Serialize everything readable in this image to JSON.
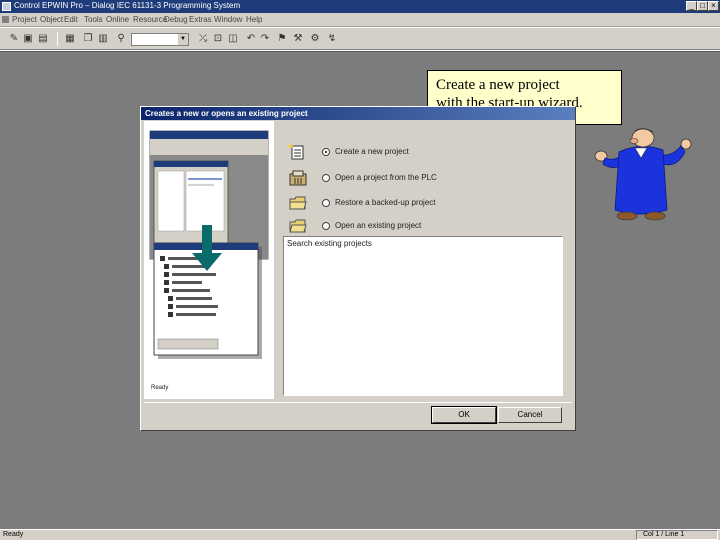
{
  "window": {
    "title": "Control EPWIN Pro – Dialog IEC 61131-3 Programming System",
    "buttons": [
      "_",
      "□",
      "×"
    ]
  },
  "menubar": {
    "items": [
      "Project",
      "Object",
      "Edit",
      "Tools",
      "Online",
      "Resource",
      "Debug",
      "Extras",
      "Window",
      "Help"
    ]
  },
  "toolbar": {
    "combo_value": ""
  },
  "callout": {
    "line1": "Create a new project",
    "line2": "with the start-up wizard."
  },
  "dialog": {
    "title": "Creates a new or opens an existing project",
    "options": [
      {
        "label": "Create a new project",
        "icon": "new-project-icon",
        "selected": true
      },
      {
        "label": "Open a project from the PLC",
        "icon": "plc-upload-icon",
        "selected": false
      },
      {
        "label": "Restore a backed-up project",
        "icon": "restore-folder-icon",
        "selected": false
      },
      {
        "label": "Open an existing project",
        "icon": "open-folder-icon",
        "selected": false
      }
    ],
    "list_label": "Search existing projects",
    "illustration_ready": "Ready",
    "ok_label": "OK",
    "cancel_label": "Cancel"
  },
  "statusbar": {
    "text": "Ready",
    "position": "Col 1 / Line 1"
  },
  "colors": {
    "titlebar": "#1f3c7a",
    "workspace": "#7c7c7c",
    "face": "#d4d0c8",
    "callout": "#ffffcc",
    "cartoon_suit": "#1a33dd"
  }
}
